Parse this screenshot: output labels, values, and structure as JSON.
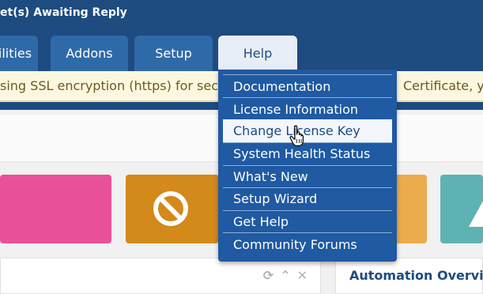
{
  "topbar": {
    "title": "et(s) Awaiting Reply"
  },
  "nav": {
    "tabs": [
      {
        "label": "ilities"
      },
      {
        "label": "Addons"
      },
      {
        "label": "Setup"
      },
      {
        "label": "Help"
      }
    ]
  },
  "alert": {
    "left_text": "sing SSL encryption (https) for securit",
    "right_text": "Certificate, you"
  },
  "help_menu": {
    "items": [
      {
        "label": "Documentation"
      },
      {
        "label": "License Information"
      },
      {
        "label": "Change License Key"
      },
      {
        "label": "System Health Status"
      },
      {
        "label": "What's New"
      },
      {
        "label": "Setup Wizard"
      },
      {
        "label": "Get Help"
      },
      {
        "label": "Community Forums"
      }
    ],
    "hovered_index": 2
  },
  "cards": {
    "right_title": "Automation Overview"
  },
  "icons": {
    "blocked": "ban-icon",
    "warning": "warning-icon",
    "refresh": "refresh-icon",
    "collapse": "chevron-up-icon",
    "close": "close-icon",
    "cursor": "hand-pointer-icon"
  }
}
